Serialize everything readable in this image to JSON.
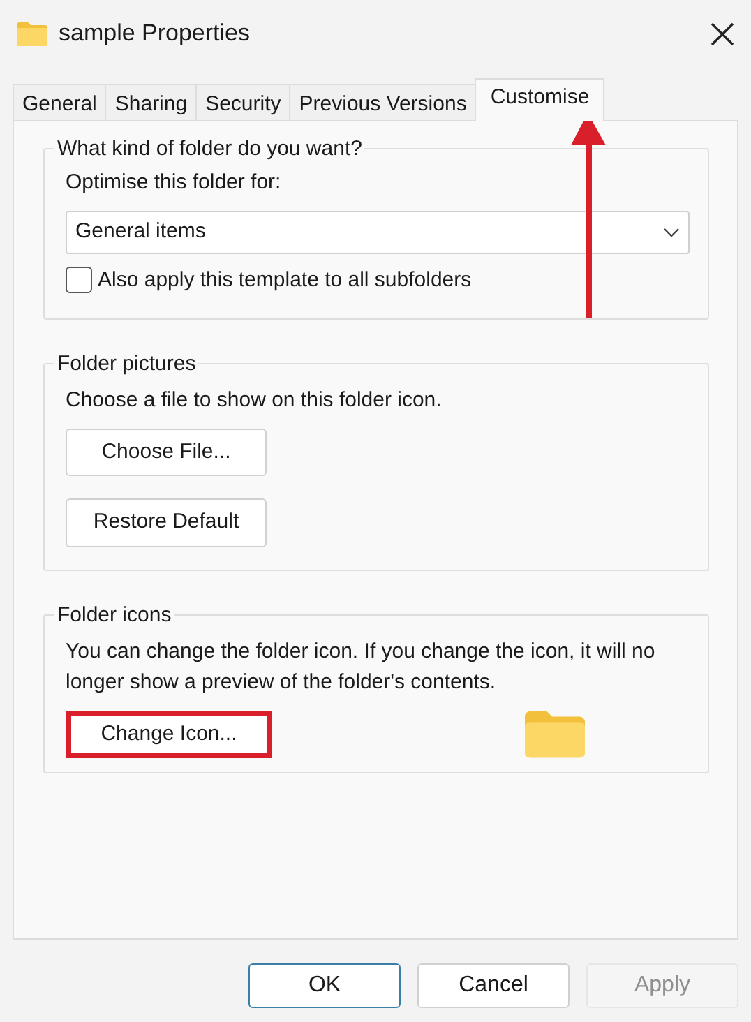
{
  "window": {
    "title": "sample Properties"
  },
  "tabs": [
    {
      "label": "General",
      "selected": false,
      "arrow": false
    },
    {
      "label": "Sharing",
      "selected": false,
      "arrow": false
    },
    {
      "label": "Security",
      "selected": false,
      "arrow": false
    },
    {
      "label": "Previous Versions",
      "selected": false,
      "arrow": false
    },
    {
      "label": "Customise",
      "selected": true,
      "arrow": true
    }
  ],
  "groups": [
    {
      "kind": "template",
      "title": "What kind of folder do you want?",
      "label": "Optimise this folder for:",
      "dropdown": "General items",
      "checkbox": {
        "label": "Also apply this template to all subfolders",
        "checked": false
      }
    },
    {
      "kind": "pictures",
      "title": "Folder pictures",
      "text": "Choose a file to show on this folder icon.",
      "buttons": [
        {
          "label": "Choose File...",
          "highlighted": false
        },
        {
          "label": "Restore Default",
          "highlighted": false
        }
      ]
    },
    {
      "kind": "icons",
      "title": "Folder icons",
      "text": "You can change the folder icon. If you change the icon, it will no longer show a preview of the folder's contents.",
      "buttons": [
        {
          "label": "Change Icon...",
          "highlighted": true
        }
      ]
    }
  ],
  "buttons": [
    {
      "label": "OK",
      "default": true,
      "disabled": false
    },
    {
      "label": "Cancel",
      "default": false,
      "disabled": false
    },
    {
      "label": "Apply",
      "default": false,
      "disabled": true
    }
  ]
}
